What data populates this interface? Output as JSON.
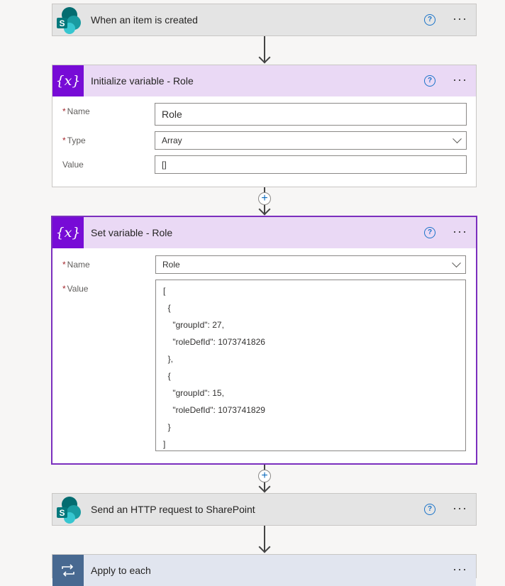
{
  "steps": {
    "trigger": {
      "title": "When an item is created",
      "icon": "sharepoint-icon"
    },
    "init_var": {
      "title": "Initialize variable - Role",
      "icon": "variable-icon",
      "fields": {
        "name_label": "Name",
        "name_value": "Role",
        "type_label": "Type",
        "type_value": "Array",
        "value_label": "Value",
        "value_value": "[]"
      }
    },
    "set_var": {
      "title": "Set variable - Role",
      "icon": "variable-icon",
      "fields": {
        "name_label": "Name",
        "name_value": "Role",
        "value_label": "Value",
        "value_lines": [
          "[",
          "  {",
          "    \"groupId\": 27,",
          "    \"roleDefId\": 1073741826",
          "  },",
          "  {",
          "    \"groupId\": 15,",
          "    \"roleDefId\": 1073741829",
          "  }",
          "]"
        ]
      }
    },
    "http": {
      "title": "Send an HTTP request to SharePoint",
      "icon": "sharepoint-icon"
    },
    "apply": {
      "title": "Apply to each",
      "icon": "loop-icon"
    }
  },
  "ui": {
    "help_glyph": "?",
    "more_glyph": "···",
    "add_glyph": "+",
    "required_mark": "*"
  },
  "colors": {
    "variable_accent": "#770bd6",
    "selected_border": "#7b2fbe",
    "help_blue": "#1a73c9",
    "loop_accent": "#486991"
  }
}
